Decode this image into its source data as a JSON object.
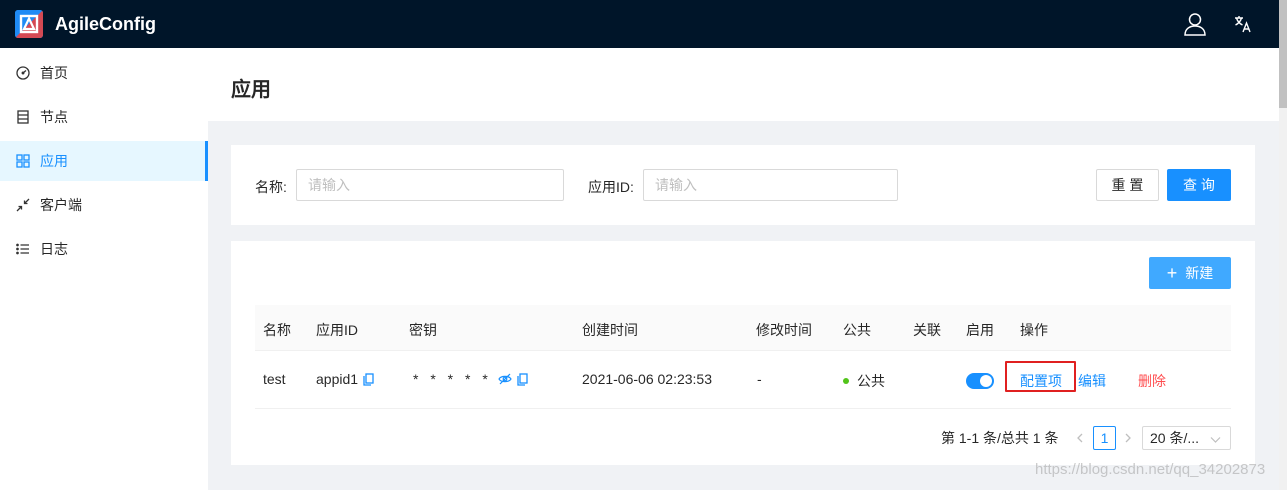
{
  "header": {
    "brand": "AgileConfig",
    "colors": {
      "bg": "#001529",
      "accent": "#1890ff"
    },
    "icons": [
      "user-icon",
      "translate-icon"
    ]
  },
  "sidebar": {
    "items": [
      {
        "label": "首页",
        "icon": "dashboard-icon",
        "active": false
      },
      {
        "label": "节点",
        "icon": "database-icon",
        "active": false
      },
      {
        "label": "应用",
        "icon": "appstore-icon",
        "active": true
      },
      {
        "label": "客户端",
        "icon": "shrink-icon",
        "active": false
      },
      {
        "label": "日志",
        "icon": "unordered-list-icon",
        "active": false
      }
    ]
  },
  "page": {
    "title": "应用"
  },
  "search": {
    "name_label": "名称:",
    "name_placeholder": "请输入",
    "appid_label": "应用ID:",
    "appid_placeholder": "请输入",
    "reset_label": "重 置",
    "query_label": "查 询"
  },
  "table": {
    "new_label": "新建",
    "columns": [
      "名称",
      "应用ID",
      "密钥",
      "创建时间",
      "修改时间",
      "公共",
      "关联",
      "启用",
      "操作"
    ],
    "rows": [
      {
        "name": "test",
        "appid": "appid1",
        "secret": "* * * * *",
        "created": "2021-06-06 02:23:53",
        "modified": "-",
        "public": "公共",
        "linked": "",
        "enabled": true,
        "actions": {
          "config": "配置项",
          "edit": "编辑",
          "delete": "删除"
        }
      }
    ]
  },
  "pagination": {
    "summary": "第 1-1 条/总共 1 条",
    "current_page": "1",
    "page_size": "20 条/..."
  },
  "watermark": "https://blog.csdn.net/qq_34202873"
}
